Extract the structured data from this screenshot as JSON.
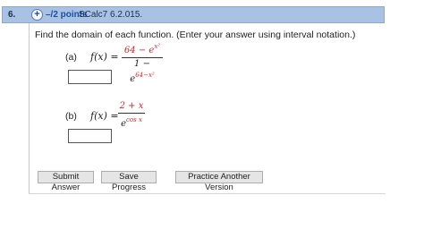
{
  "question": {
    "number": "6.",
    "expand_icon": "plus-circle-icon",
    "points": "–/2 points",
    "source": "SCalc7 6.2.015."
  },
  "instructions": "Find the domain of each function. (Enter your answer using interval notation.)",
  "parts": [
    {
      "label": "(a)",
      "function_name": "f(x) =",
      "numerator_main": "64 − e",
      "numerator_exp": "x²",
      "denominator_main": "1 − e",
      "denominator_exp": "64−x²",
      "answer_value": ""
    },
    {
      "label": "(b)",
      "function_name": "f(x) =",
      "numerator_main": "2 + x",
      "denominator_main": "e",
      "denominator_exp": "cos x",
      "answer_value": ""
    }
  ],
  "buttons": {
    "submit": "Submit Answer",
    "save": "Save Progress",
    "practice": "Practice Another Version"
  },
  "colors": {
    "header_bg": "#a9c2e3",
    "points": "#1d4fa7",
    "math_highlight": "#d0282a"
  }
}
